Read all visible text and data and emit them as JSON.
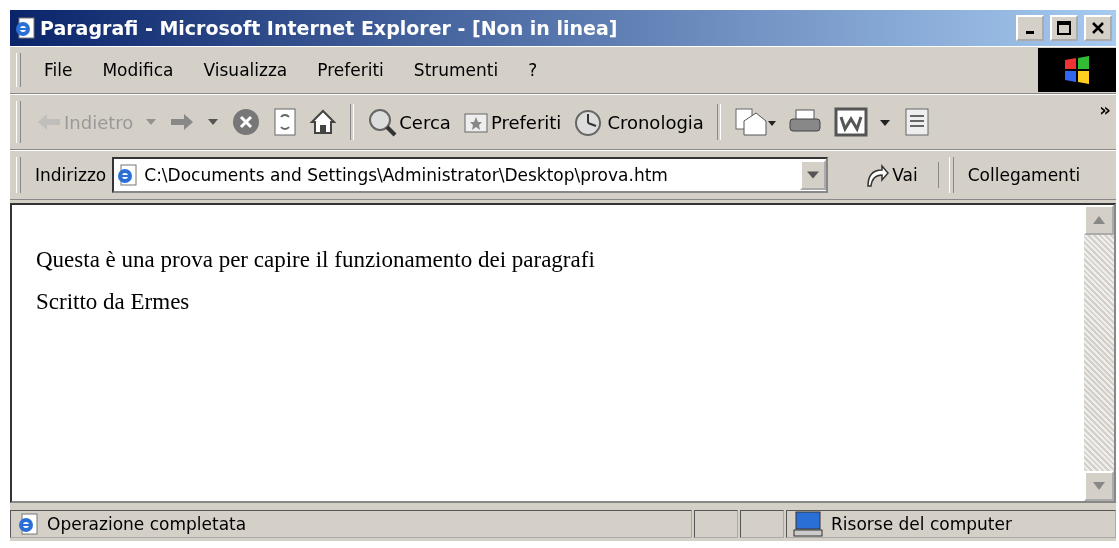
{
  "window": {
    "title": "Paragrafi - Microsoft Internet Explorer - [Non in linea]"
  },
  "menu": [
    "File",
    "Modifica",
    "Visualizza",
    "Preferiti",
    "Strumenti",
    "?"
  ],
  "toolbar": [
    {
      "kind": "back",
      "label": "Indietro",
      "disabled": true
    },
    {
      "kind": "forward",
      "disabled": false
    },
    {
      "kind": "stop",
      "disabled": false
    },
    {
      "kind": "refresh",
      "disabled": false
    },
    {
      "kind": "home",
      "disabled": false
    },
    {
      "kind": "search",
      "label": "Cerca",
      "disabled": false
    },
    {
      "kind": "favorites",
      "label": "Preferiti",
      "disabled": false
    },
    {
      "kind": "history",
      "label": "Cronologia",
      "disabled": false
    },
    {
      "kind": "mail",
      "disabled": false
    },
    {
      "kind": "print",
      "disabled": false
    },
    {
      "kind": "edit",
      "disabled": false
    },
    {
      "kind": "discuss",
      "disabled": false
    },
    {
      "kind": "more",
      "label": "»",
      "disabled": false
    }
  ],
  "address_bar": {
    "label": "Indirizzo",
    "value": "C:\\Documents and Settings\\Administrator\\Desktop\\prova.htm",
    "go": "Vai",
    "links": "Collegamenti"
  },
  "content": {
    "paragraphs": [
      "Questa è una prova per capire il funzionamento dei paragrafi",
      "Scritto da Ermes"
    ]
  },
  "status_bar": {
    "message": "Operazione completata",
    "zone": "Risorse del computer"
  }
}
